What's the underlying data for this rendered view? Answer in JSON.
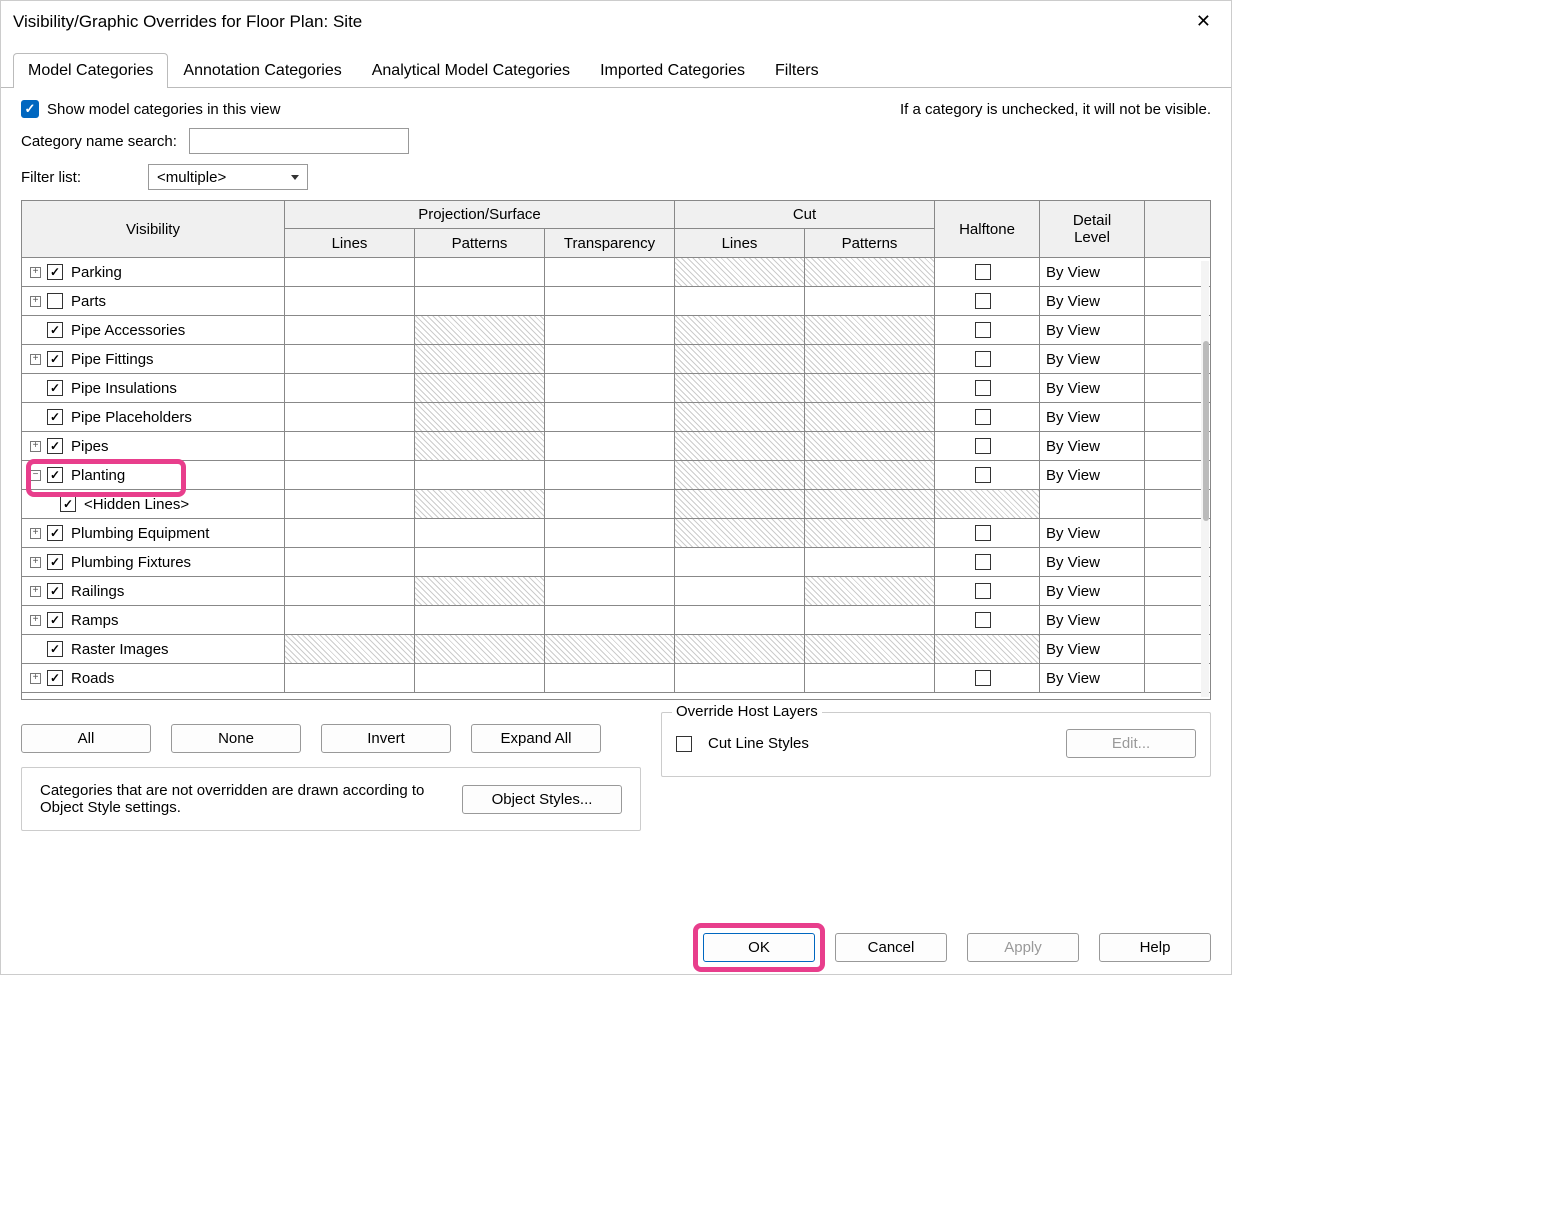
{
  "dialog": {
    "title": "Visibility/Graphic Overrides for Floor Plan: Site"
  },
  "tabs": [
    {
      "label": "Model Categories",
      "active": true
    },
    {
      "label": "Annotation Categories",
      "active": false
    },
    {
      "label": "Analytical Model Categories",
      "active": false
    },
    {
      "label": "Imported Categories",
      "active": false
    },
    {
      "label": "Filters",
      "active": false
    }
  ],
  "top": {
    "show_checkbox_label": "Show model categories in this view",
    "show_checked": true,
    "note": "If a category is unchecked, it will not be visible.",
    "search_label": "Category name search:",
    "filter_label": "Filter list:",
    "filter_value": "<multiple>"
  },
  "columns": {
    "visibility": "Visibility",
    "projection": "Projection/Surface",
    "cut": "Cut",
    "halftone": "Halftone",
    "detail": "Detail Level",
    "lines": "Lines",
    "patterns": "Patterns",
    "transparency": "Transparency"
  },
  "rows": [
    {
      "expand": "plus",
      "checked": true,
      "label": "Parking",
      "pattHatch": false,
      "cutLinesHatch": true,
      "cutPattHatch": true,
      "halftoneHatch": false,
      "halfCb": true,
      "detail": "By View"
    },
    {
      "expand": "plus",
      "checked": false,
      "label": "Parts",
      "pattHatch": false,
      "cutLinesHatch": false,
      "cutPattHatch": false,
      "halftoneHatch": false,
      "halfCb": true,
      "detail": "By View"
    },
    {
      "expand": "none",
      "checked": true,
      "label": "Pipe Accessories",
      "pattHatch": true,
      "cutLinesHatch": true,
      "cutPattHatch": true,
      "halftoneHatch": false,
      "halfCb": true,
      "detail": "By View"
    },
    {
      "expand": "plus",
      "checked": true,
      "label": "Pipe Fittings",
      "pattHatch": true,
      "cutLinesHatch": true,
      "cutPattHatch": true,
      "halftoneHatch": false,
      "halfCb": true,
      "detail": "By View"
    },
    {
      "expand": "none",
      "checked": true,
      "label": "Pipe Insulations",
      "pattHatch": true,
      "cutLinesHatch": true,
      "cutPattHatch": true,
      "halftoneHatch": false,
      "halfCb": true,
      "detail": "By View"
    },
    {
      "expand": "none",
      "checked": true,
      "label": "Pipe Placeholders",
      "pattHatch": true,
      "cutLinesHatch": true,
      "cutPattHatch": true,
      "halftoneHatch": false,
      "halfCb": true,
      "detail": "By View"
    },
    {
      "expand": "plus",
      "checked": true,
      "label": "Pipes",
      "pattHatch": true,
      "cutLinesHatch": true,
      "cutPattHatch": true,
      "halftoneHatch": false,
      "halfCb": true,
      "detail": "By View"
    },
    {
      "expand": "minus",
      "checked": true,
      "label": "Planting",
      "pattHatch": false,
      "cutLinesHatch": true,
      "cutPattHatch": true,
      "halftoneHatch": false,
      "halfCb": true,
      "detail": "By View",
      "highlight": true
    },
    {
      "expand": "child",
      "checked": true,
      "label": "<Hidden Lines>",
      "pattHatch": true,
      "cutLinesHatch": true,
      "cutPattHatch": true,
      "halftoneHatch": true,
      "halfCb": false,
      "detail": ""
    },
    {
      "expand": "plus",
      "checked": true,
      "label": "Plumbing Equipment",
      "pattHatch": false,
      "cutLinesHatch": true,
      "cutPattHatch": true,
      "halftoneHatch": false,
      "halfCb": true,
      "detail": "By View"
    },
    {
      "expand": "plus",
      "checked": true,
      "label": "Plumbing Fixtures",
      "pattHatch": false,
      "cutLinesHatch": false,
      "cutPattHatch": false,
      "halftoneHatch": false,
      "halfCb": true,
      "detail": "By View"
    },
    {
      "expand": "plus",
      "checked": true,
      "label": "Railings",
      "pattHatch": true,
      "cutLinesHatch": false,
      "cutPattHatch": true,
      "halftoneHatch": false,
      "halfCb": true,
      "detail": "By View"
    },
    {
      "expand": "plus",
      "checked": true,
      "label": "Ramps",
      "pattHatch": false,
      "cutLinesHatch": false,
      "cutPattHatch": false,
      "halftoneHatch": false,
      "halfCb": true,
      "detail": "By View"
    },
    {
      "expand": "none",
      "checked": true,
      "label": "Raster Images",
      "linesHatch": true,
      "pattHatch": true,
      "transHatch": true,
      "cutLinesHatch": true,
      "cutPattHatch": true,
      "halftoneHatch": true,
      "halfCb": false,
      "detail": "By View"
    },
    {
      "expand": "plus",
      "checked": true,
      "label": "Roads",
      "pattHatch": false,
      "cutLinesHatch": false,
      "cutPattHatch": false,
      "halftoneHatch": false,
      "halfCb": true,
      "detail": "By View"
    }
  ],
  "buttons": {
    "all": "All",
    "none": "None",
    "invert": "Invert",
    "expand_all": "Expand All",
    "object_styles": "Object Styles...",
    "edit": "Edit...",
    "ok": "OK",
    "cancel": "Cancel",
    "apply": "Apply",
    "help": "Help"
  },
  "info_text": "Categories that are not overridden are drawn according to Object Style settings.",
  "host_layers": {
    "legend": "Override Host Layers",
    "cut_line_styles": "Cut Line Styles"
  }
}
